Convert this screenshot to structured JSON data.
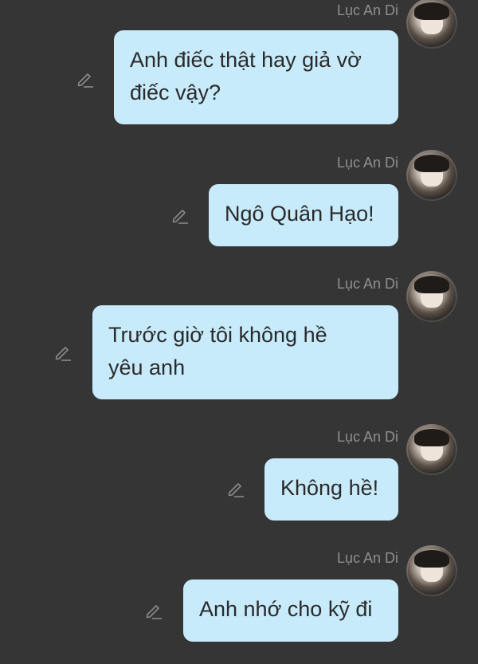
{
  "messages": [
    {
      "sender": "Lục An Di",
      "lines": [
        "Anh điếc thật hay giả vờ",
        "điếc vậy?"
      ]
    },
    {
      "sender": "Lục An Di",
      "lines": [
        "Ngô Quân Hạo!"
      ]
    },
    {
      "sender": "Lục An Di",
      "lines": [
        "Trước giờ tôi không hề",
        "yêu anh"
      ]
    },
    {
      "sender": "Lục An Di",
      "lines": [
        "Không hề!"
      ]
    },
    {
      "sender": "Lục An Di",
      "lines": [
        "Anh nhớ cho kỹ đi"
      ]
    }
  ],
  "icons": {
    "edit": "pencil-edit-icon",
    "avatar": "profile-avatar"
  },
  "colors": {
    "background": "#353535",
    "bubble": "#c8ebfb",
    "text": "#2a2a2a",
    "sender": "#8f8f8f"
  }
}
